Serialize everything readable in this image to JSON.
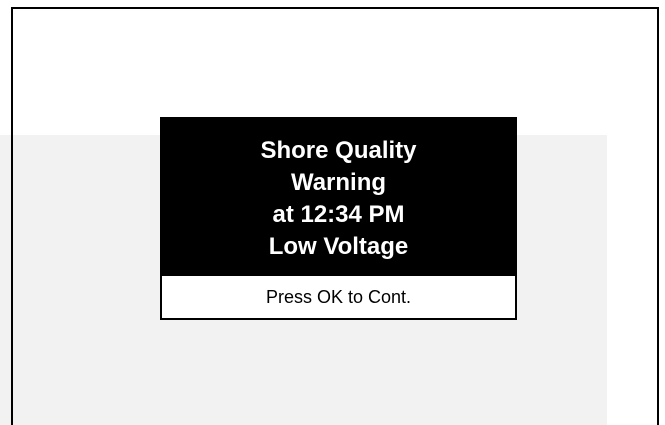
{
  "alert": {
    "lines": [
      "Shore Quality",
      "Warning",
      "at 12:34 PM",
      "Low Voltage"
    ],
    "prompt": "Press OK to Cont."
  },
  "colors": {
    "header_background": "#000000",
    "header_text": "#ffffff",
    "footer_background": "#ffffff",
    "footer_text": "#000000",
    "band_background": "#f2f2f2"
  }
}
